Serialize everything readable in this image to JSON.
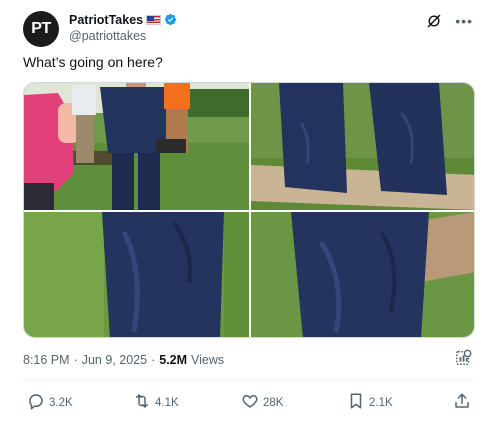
{
  "author": {
    "avatar_text": "PT",
    "display_name": "PatriotTakes",
    "flag_icon": "us-flag-icon",
    "verified_icon": "verified-badge-icon",
    "verified_color": "#1d9bf0",
    "handle": "@patriottakes"
  },
  "tweet": {
    "text": "What’s going on here?"
  },
  "media": {
    "images": [
      "photo-grass-crowd-suit",
      "photo-pant-legs-closeup",
      "photo-pant-leg-zoom-left",
      "photo-pant-leg-zoom-right"
    ]
  },
  "meta": {
    "time": "8:16 PM",
    "separator": "·",
    "date": "Jun 9, 2025",
    "views_count": "5.2M",
    "views_label": "Views"
  },
  "actions": {
    "replies": "3.2K",
    "reposts": "4.1K",
    "likes": "28K",
    "bookmarks": "2.1K"
  },
  "colors": {
    "text_primary": "#0f1419",
    "text_secondary": "#536471",
    "border": "#cfd9de"
  }
}
